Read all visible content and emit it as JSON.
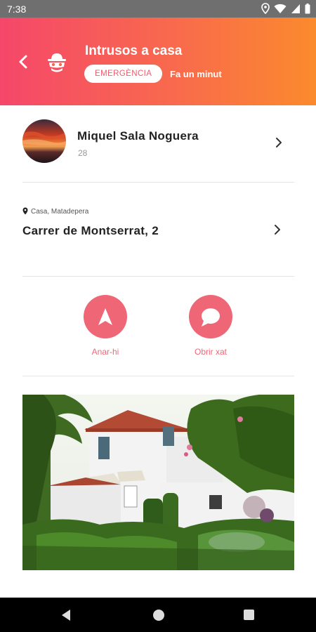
{
  "status_bar": {
    "time": "7:38",
    "icons": [
      "location-icon",
      "wifi-icon",
      "signal-icon",
      "battery-icon"
    ]
  },
  "header": {
    "title": "Intrusos a casa",
    "badge": "EMERGÈNCIA",
    "time_ago": "Fa un minut",
    "back_icon": "chevron-left-icon",
    "alert_icon": "burglar-icon"
  },
  "profile": {
    "name": "Miquel Sala Noguera",
    "age": "28",
    "avatar": "sunset-avatar"
  },
  "location": {
    "label": "Casa, Matadepera",
    "address": "Carrer de Montserrat, 2"
  },
  "actions": [
    {
      "label": "Anar-hi",
      "icon": "navigate-icon"
    },
    {
      "label": "Obrir xat",
      "icon": "chat-icon"
    }
  ],
  "photo": {
    "description_icon": "house-photo"
  },
  "colors": {
    "header_gradient_start": "#f5476a",
    "header_gradient_end": "#fb8a2d",
    "accent": "#ef6677",
    "status_bar": "#6f6f6f"
  }
}
